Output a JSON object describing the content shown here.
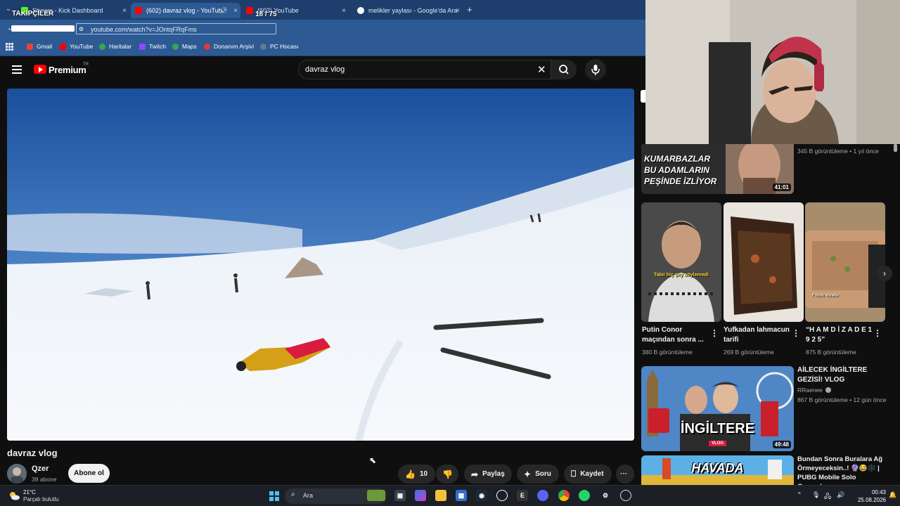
{
  "browser": {
    "overlay_followers": "TAKİPÇİLER",
    "overlay_count": "18 / 75",
    "tabs": [
      {
        "title": "Stream - Kick Dashboard",
        "icon": "kick-icon"
      },
      {
        "title": "(602) davraz vlog - YouTube",
        "icon": "youtube-icon",
        "active": true
      },
      {
        "title": "(602) YouTube",
        "icon": "youtube-icon"
      },
      {
        "title": "melikler yaylası - Google'da Ara",
        "icon": "google-icon"
      }
    ],
    "new_tab": "+",
    "close_glyph": "×",
    "url": "youtube.com/watch?v=JOntqFRqFms",
    "bookmarks": [
      {
        "label": "Gmail",
        "color": "#ea4335"
      },
      {
        "label": "YouTube",
        "color": "#ff0000"
      },
      {
        "label": "Haritalar",
        "color": "#34a853"
      },
      {
        "label": "Twitch",
        "color": "#9146ff"
      },
      {
        "label": "Maps",
        "color": "#34a853"
      },
      {
        "label": "Donanım Arşivi",
        "color": "#e53935"
      },
      {
        "label": "PC Hocası",
        "color": "#607d8b"
      }
    ]
  },
  "youtube": {
    "brand": "Premium",
    "region": "TR",
    "search_query": "davraz vlog",
    "video": {
      "title": "davraz vlog",
      "channel": "Qzer",
      "subscribers": "39 abone",
      "subscribe_label": "Abone ol",
      "likes": "10",
      "share_label": "Paylaş",
      "ask_label": "Soru",
      "save_label": "Kaydet",
      "more_label": "···"
    },
    "sidebar": {
      "top_video": {
        "thumb_text": [
          "KUMARBAZLAR",
          "BU ADAMLARIN",
          "PEŞİNDE İZLİYOR"
        ],
        "duration": "41:01",
        "meta": "345 B görüntüleme • 1 yıl önce"
      },
      "shorts": [
        {
          "title": "Putin Conor maçından sonra ...",
          "views": "380 B görüntüleme",
          "caption": "Tabii hiç şey söylemedi"
        },
        {
          "title": "Yufkadan lahmacun tarifi",
          "views": "269 B görüntüleme"
        },
        {
          "title": "“H A M D İ Z A D E 1 9 2 5”",
          "views": "875 B görüntüleme",
          "caption": "Fıstıklı künefe"
        }
      ],
      "videos": [
        {
          "title": "AİLECEK İNGİLTERE GEZİSİ! VLOG",
          "channel": "RRaenee",
          "meta": "867 B görüntüleme • 12 gün önce",
          "duration": "49:48",
          "thumb_text": "İNGİLTERE",
          "badge": "VLOG"
        },
        {
          "title": "Bundan Sonra Buralara Ağ Örmeyeceksin..! 🔮😂🕸️ | PUBG Mobile Solo Gameplay",
          "thumb_text": "HAVADA"
        }
      ]
    }
  },
  "taskbar": {
    "temperature": "21°C",
    "condition": "Parçalı bulutlu",
    "search_placeholder": "Ara",
    "time": "00:43",
    "date": "25.08.2026"
  }
}
